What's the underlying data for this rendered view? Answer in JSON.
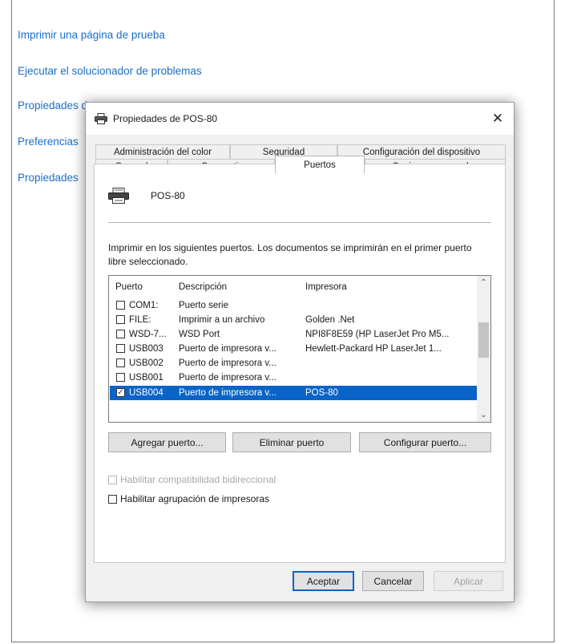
{
  "background": {
    "links": [
      "Imprimir una página de prueba",
      "Ejecutar el solucionador de problemas",
      "Propiedades de impresora",
      "Preferencias",
      "Propiedades"
    ]
  },
  "dialog": {
    "title": "Propiedades de POS-80",
    "close_glyph": "✕",
    "tabs_back": [
      "Administración del color",
      "Seguridad",
      "Configuración del dispositivo"
    ],
    "tabs_front": [
      "General",
      "Compartir",
      "Puertos",
      "Opciones avanzadas"
    ],
    "active_tab": "Puertos",
    "printer_name": "POS-80",
    "description": "Imprimir en los siguientes puertos. Los documentos se imprimirán en el primer puerto libre seleccionado.",
    "ports": {
      "headers": [
        "Puerto",
        "Descripción",
        "Impresora"
      ],
      "rows": [
        {
          "port": "COM1:",
          "desc": "Puerto serie",
          "printer": "",
          "checked": false
        },
        {
          "port": "FILE:",
          "desc": "Imprimir a un archivo",
          "printer": "Golden .Net",
          "checked": false
        },
        {
          "port": "WSD-7...",
          "desc": "WSD Port",
          "printer": "NPI8F8E59 (HP LaserJet Pro M5...",
          "checked": false
        },
        {
          "port": "USB003",
          "desc": "Puerto de impresora v...",
          "printer": "Hewlett-Packard HP LaserJet 1...",
          "checked": false
        },
        {
          "port": "USB002",
          "desc": "Puerto de impresora v...",
          "printer": "",
          "checked": false
        },
        {
          "port": "USB001",
          "desc": "Puerto de impresora v...",
          "printer": "",
          "checked": false
        },
        {
          "port": "USB004",
          "desc": "Puerto de impresora v...",
          "printer": "POS-80",
          "checked": true
        }
      ],
      "selected_index": 6,
      "check_glyph": "✓"
    },
    "port_buttons": {
      "add": "Agregar puerto...",
      "delete": "Eliminar puerto",
      "configure": "Configurar puerto..."
    },
    "options": {
      "bidirectional": {
        "label": "Habilitar compatibilidad bidireccional",
        "enabled": false,
        "checked": false
      },
      "pooling": {
        "label": "Habilitar agrupación de impresoras",
        "enabled": true,
        "checked": false
      }
    },
    "footer": {
      "ok": "Aceptar",
      "cancel": "Cancelar",
      "apply": "Aplicar"
    },
    "colors": {
      "link": "#1a6fc9",
      "selection": "#0a64c8"
    },
    "icons": {
      "title": "printer-icon",
      "header": "printer-icon",
      "scroll_up": "chevron-up-icon",
      "scroll_down": "chevron-down-icon"
    },
    "scroll_glyphs": {
      "up": "⌃",
      "down": "⌄"
    }
  }
}
